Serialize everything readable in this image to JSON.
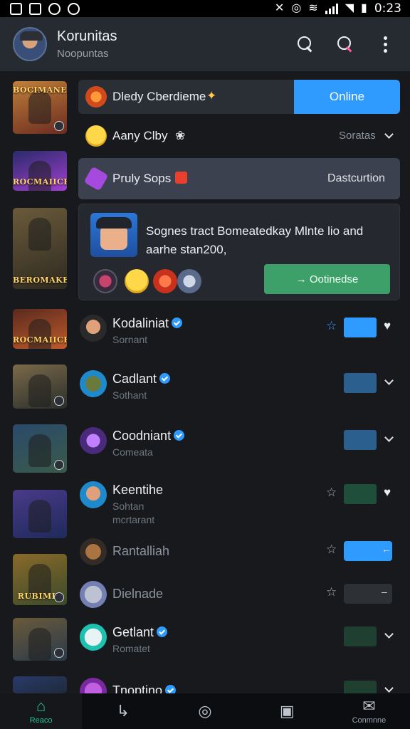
{
  "status_bar": {
    "time": "0:23"
  },
  "header": {
    "title": "Korunitas",
    "subtitle": "Noopuntas"
  },
  "rail": [
    {
      "label": "BOCIMANE",
      "colors": [
        "#c0803a",
        "#6b2b20"
      ]
    },
    {
      "label": "ROCMAIICE",
      "colors": [
        "#2a2a6a",
        "#a040d0"
      ]
    },
    {
      "label": "BEROMAKER",
      "colors": [
        "#6a5a3a",
        "#2e2a20"
      ]
    },
    {
      "label": "ROCMAIICE",
      "colors": [
        "#5a2a1e",
        "#c05a2a"
      ]
    },
    {
      "label": "",
      "colors": [
        "#7a6a4a",
        "#2a2e2a"
      ]
    },
    {
      "label": "",
      "colors": [
        "#2a4a6a",
        "#3a5a4a"
      ]
    },
    {
      "label": "",
      "colors": [
        "#4a3a8a",
        "#1e2a5a"
      ]
    },
    {
      "label": "RUBIMIE",
      "colors": [
        "#8a6a2a",
        "#3a4a2a"
      ]
    },
    {
      "label": "",
      "colors": [
        "#6a5a3a",
        "#2a3a4a"
      ]
    },
    {
      "label": "",
      "colors": [
        "#2a3a6a",
        "#1e2a3a"
      ]
    }
  ],
  "featured": {
    "row1": {
      "text": "Dledy Cberdieme",
      "button": "Online"
    },
    "row2": {
      "text": "Aany Clby",
      "status": "Soratas"
    },
    "row3": {
      "text": "Pruly Sops",
      "right": "Dastcurtion"
    },
    "card": {
      "message_line1": "Sognes tract Bomeatedkay  Mlnte lio and",
      "message_line2": "aarhe stan200,",
      "button": "→ Ootinedse"
    }
  },
  "list": [
    {
      "name": "Kodaliniat",
      "sub": "Sornant",
      "verified": true,
      "star": "☆",
      "square": "#2f9bff",
      "end": "heart"
    },
    {
      "name": "Cadlant",
      "sub": "Sothant",
      "verified": true,
      "star": "",
      "square": "#2b5f8e",
      "end": "chevron"
    },
    {
      "name": "Coodniant",
      "sub": "Comeata",
      "verified": true,
      "star": "",
      "square": "#2b5f8e",
      "end": "chevron"
    },
    {
      "name": "Keentihe",
      "sub": "Sohtan",
      "sub2": "mcrtarant",
      "verified": false,
      "star": "☆",
      "square": "#1f4f3a",
      "end": "heart"
    },
    {
      "name": "Rantalliah",
      "sub": "",
      "verified": false,
      "star": "☆",
      "square": "#2f9bff",
      "end": "arrow"
    },
    {
      "name": "Dielnade",
      "sub": "",
      "verified": false,
      "star": "☆",
      "square": "#2d3035",
      "end": "dash"
    },
    {
      "name": "Getlant",
      "sub": "Romatet",
      "verified": true,
      "star": "",
      "square": "#1f4030",
      "end": "chevron"
    },
    {
      "name": "Tnoptino",
      "sub": "",
      "verified": true,
      "star": "",
      "square": "#1f4030",
      "end": "chevron"
    }
  ],
  "bottom_nav": [
    {
      "label": "Reaco",
      "icon": "home-icon",
      "glyph": "⌂",
      "active": true
    },
    {
      "label": "",
      "icon": "share-icon",
      "glyph": "↳",
      "active": false
    },
    {
      "label": "",
      "icon": "compass-icon",
      "glyph": "◎",
      "active": false
    },
    {
      "label": "",
      "icon": "bookmark-icon",
      "glyph": "▣",
      "active": false
    },
    {
      "label": "Conmnne",
      "icon": "chat-icon",
      "glyph": "✉",
      "active": false
    }
  ]
}
